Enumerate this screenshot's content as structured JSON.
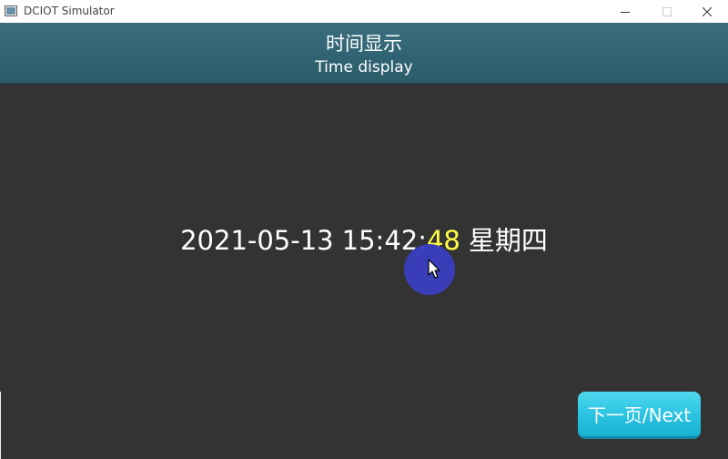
{
  "window": {
    "title": "DCIOT Simulator"
  },
  "header": {
    "title_cn": "时间显示",
    "title_en": "Time display"
  },
  "clock": {
    "date": "2021-05-13",
    "time_hm": "15:42:",
    "seconds": "48",
    "weekday": "星期四"
  },
  "next_button": {
    "label": "下一页/Next"
  },
  "colors": {
    "background": "#333333",
    "header": "#306473",
    "seconds_highlight": "#ffff44",
    "button": "#2cc4e2",
    "cursor_highlight": "#3a3ec0"
  }
}
